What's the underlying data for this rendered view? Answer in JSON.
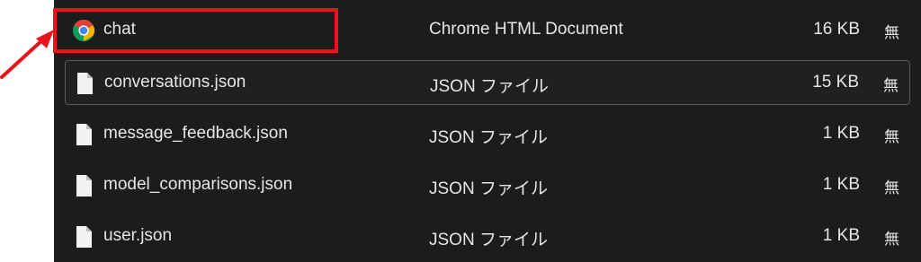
{
  "files": [
    {
      "name": "chat",
      "type": "Chrome HTML Document",
      "size": "16 KB",
      "attr": "無",
      "icon": "chrome-icon"
    },
    {
      "name": "conversations.json",
      "type": "JSON ファイル",
      "size": "15 KB",
      "attr": "無",
      "icon": "file-icon"
    },
    {
      "name": "message_feedback.json",
      "type": "JSON ファイル",
      "size": "1 KB",
      "attr": "無",
      "icon": "file-icon"
    },
    {
      "name": "model_comparisons.json",
      "type": "JSON ファイル",
      "size": "1 KB",
      "attr": "無",
      "icon": "file-icon"
    },
    {
      "name": "user.json",
      "type": "JSON ファイル",
      "size": "1 KB",
      "attr": "無",
      "icon": "file-icon"
    }
  ],
  "annotation": {
    "highlighted_file": "chat",
    "color": "#e8141c"
  },
  "colors": {
    "background": "#1c1c1c",
    "text": "#e6e6e6",
    "focus_border": "#5a5a5a"
  }
}
